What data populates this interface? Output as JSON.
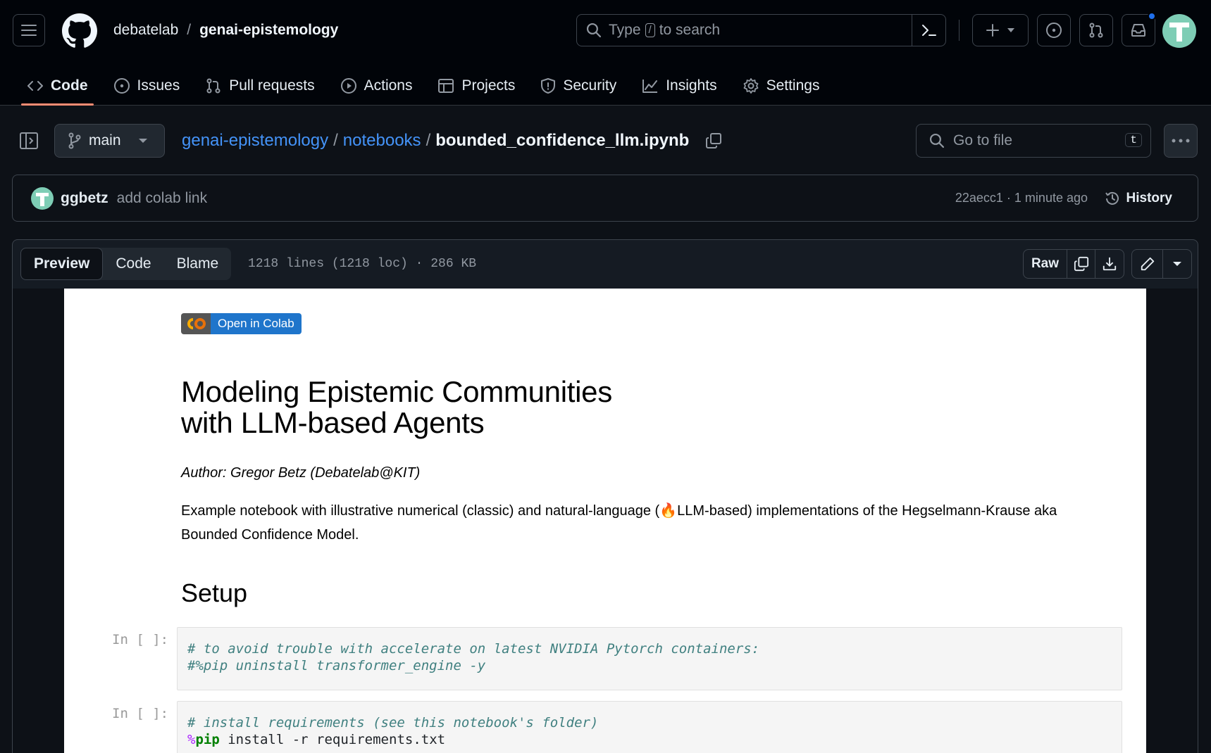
{
  "header": {
    "owner": "debatelab",
    "separator": "/",
    "repo": "genai-epistemology",
    "search_prefix": "Type",
    "search_key": "/",
    "search_suffix": "to search"
  },
  "nav": {
    "tabs": [
      {
        "label": "Code",
        "icon": "code-icon"
      },
      {
        "label": "Issues",
        "icon": "issue-icon"
      },
      {
        "label": "Pull requests",
        "icon": "pull-request-icon"
      },
      {
        "label": "Actions",
        "icon": "play-icon"
      },
      {
        "label": "Projects",
        "icon": "table-icon"
      },
      {
        "label": "Security",
        "icon": "shield-icon"
      },
      {
        "label": "Insights",
        "icon": "graph-icon"
      },
      {
        "label": "Settings",
        "icon": "gear-icon"
      }
    ]
  },
  "file": {
    "branch": "main",
    "path_repo": "genai-epistemology",
    "path_folder": "notebooks",
    "path_sep": "/",
    "filename": "bounded_confidence_llm.ipynb",
    "goto_placeholder": "Go to file",
    "goto_key": "t"
  },
  "commit": {
    "author": "ggbetz",
    "message": "add colab link",
    "meta": "22aecc1 · 1 minute ago",
    "history_label": "History"
  },
  "viewer": {
    "tabs": [
      "Preview",
      "Code",
      "Blame"
    ],
    "info": "1218 lines (1218 loc) · 286 KB",
    "raw_label": "Raw"
  },
  "notebook": {
    "badge_logo": "CO",
    "badge_text": "Open in Colab",
    "title_line1": "Modeling Epistemic Communities",
    "title_line2": "with LLM-based Agents",
    "author": "Author: Gregor Betz (Debatelab@KIT)",
    "intro_before": "Example notebook with illustrative numerical (classic) and natural-language (",
    "intro_emoji": "🔥",
    "intro_after": "LLM-based) implementations of the Hegselmann-Krause aka Bounded Confidence Model.",
    "setup_heading": "Setup",
    "cells": [
      {
        "prompt": "In [ ]:",
        "line1": "# to avoid trouble with accelerate on latest NVIDIA Pytorch containers:",
        "line2": "#%pip uninstall transformer_engine -y"
      },
      {
        "prompt": "In [ ]:",
        "line1": "# install requirements (see this notebook's folder)",
        "line2_magic": "%",
        "line2_kw": "pip",
        "line2_rest": " install -r requirements.txt"
      }
    ]
  },
  "colors": {
    "bg": "#0d1117",
    "header_bg": "#010409",
    "link": "#4493f8",
    "active_underline": "#fd8c73",
    "notification_dot": "#1f6feb"
  }
}
